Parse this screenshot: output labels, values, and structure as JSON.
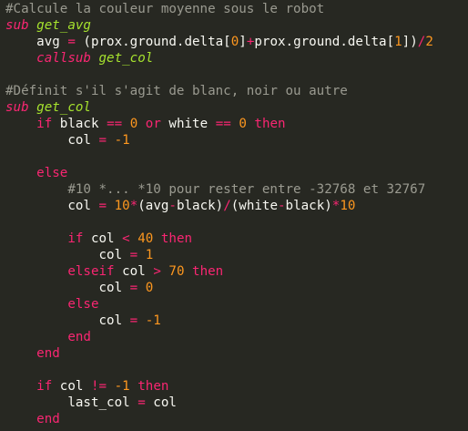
{
  "editor": {
    "lines": [
      [
        {
          "t": "#Calcule la couleur moyenne sous le robot",
          "c": "cm"
        }
      ],
      [
        {
          "t": "sub",
          "c": "sub"
        },
        {
          "t": " ",
          "c": "tx"
        },
        {
          "t": "get_avg",
          "c": "fn"
        }
      ],
      [
        {
          "t": "    avg ",
          "c": "tx"
        },
        {
          "t": "=",
          "c": "op"
        },
        {
          "t": " (prox.ground.delta[",
          "c": "tx"
        },
        {
          "t": "0",
          "c": "nm"
        },
        {
          "t": "]",
          "c": "tx"
        },
        {
          "t": "+",
          "c": "op"
        },
        {
          "t": "prox.ground.delta[",
          "c": "tx"
        },
        {
          "t": "1",
          "c": "nm"
        },
        {
          "t": "])",
          "c": "tx"
        },
        {
          "t": "/",
          "c": "op"
        },
        {
          "t": "2",
          "c": "nm"
        }
      ],
      [
        {
          "t": "    ",
          "c": "tx"
        },
        {
          "t": "callsub",
          "c": "sub"
        },
        {
          "t": " ",
          "c": "tx"
        },
        {
          "t": "get_col",
          "c": "fn"
        }
      ],
      [
        {
          "t": "",
          "c": "tx"
        }
      ],
      [
        {
          "t": "#Définit s'il s'agit de blanc, noir ou autre",
          "c": "cm"
        }
      ],
      [
        {
          "t": "sub",
          "c": "sub"
        },
        {
          "t": " ",
          "c": "tx"
        },
        {
          "t": "get_col",
          "c": "fn"
        }
      ],
      [
        {
          "t": "    ",
          "c": "tx"
        },
        {
          "t": "if",
          "c": "kw"
        },
        {
          "t": " black ",
          "c": "tx"
        },
        {
          "t": "==",
          "c": "op"
        },
        {
          "t": " ",
          "c": "tx"
        },
        {
          "t": "0",
          "c": "nm"
        },
        {
          "t": " ",
          "c": "tx"
        },
        {
          "t": "or",
          "c": "kw"
        },
        {
          "t": " white ",
          "c": "tx"
        },
        {
          "t": "==",
          "c": "op"
        },
        {
          "t": " ",
          "c": "tx"
        },
        {
          "t": "0",
          "c": "nm"
        },
        {
          "t": " ",
          "c": "tx"
        },
        {
          "t": "then",
          "c": "kw"
        }
      ],
      [
        {
          "t": "        col ",
          "c": "tx"
        },
        {
          "t": "=",
          "c": "op"
        },
        {
          "t": " ",
          "c": "tx"
        },
        {
          "t": "-1",
          "c": "nm"
        }
      ],
      [
        {
          "t": "",
          "c": "tx"
        }
      ],
      [
        {
          "t": "    ",
          "c": "tx"
        },
        {
          "t": "else",
          "c": "kw"
        }
      ],
      [
        {
          "t": "        #10 *... *10 pour rester entre -32768 et 32767",
          "c": "cm"
        }
      ],
      [
        {
          "t": "        col ",
          "c": "tx"
        },
        {
          "t": "=",
          "c": "op"
        },
        {
          "t": " ",
          "c": "tx"
        },
        {
          "t": "10",
          "c": "nm"
        },
        {
          "t": "*",
          "c": "op"
        },
        {
          "t": "(avg",
          "c": "tx"
        },
        {
          "t": "-",
          "c": "op"
        },
        {
          "t": "black)",
          "c": "tx"
        },
        {
          "t": "/",
          "c": "op"
        },
        {
          "t": "(white",
          "c": "tx"
        },
        {
          "t": "-",
          "c": "op"
        },
        {
          "t": "black)",
          "c": "tx"
        },
        {
          "t": "*",
          "c": "op"
        },
        {
          "t": "10",
          "c": "nm"
        }
      ],
      [
        {
          "t": "",
          "c": "tx"
        }
      ],
      [
        {
          "t": "        ",
          "c": "tx"
        },
        {
          "t": "if",
          "c": "kw"
        },
        {
          "t": " col ",
          "c": "tx"
        },
        {
          "t": "<",
          "c": "op"
        },
        {
          "t": " ",
          "c": "tx"
        },
        {
          "t": "40",
          "c": "nm"
        },
        {
          "t": " ",
          "c": "tx"
        },
        {
          "t": "then",
          "c": "kw"
        }
      ],
      [
        {
          "t": "            col ",
          "c": "tx"
        },
        {
          "t": "=",
          "c": "op"
        },
        {
          "t": " ",
          "c": "tx"
        },
        {
          "t": "1",
          "c": "nm"
        }
      ],
      [
        {
          "t": "        ",
          "c": "tx"
        },
        {
          "t": "elseif",
          "c": "kw"
        },
        {
          "t": " col ",
          "c": "tx"
        },
        {
          "t": ">",
          "c": "op"
        },
        {
          "t": " ",
          "c": "tx"
        },
        {
          "t": "70",
          "c": "nm"
        },
        {
          "t": " ",
          "c": "tx"
        },
        {
          "t": "then",
          "c": "kw"
        }
      ],
      [
        {
          "t": "            col ",
          "c": "tx"
        },
        {
          "t": "=",
          "c": "op"
        },
        {
          "t": " ",
          "c": "tx"
        },
        {
          "t": "0",
          "c": "nm"
        }
      ],
      [
        {
          "t": "        ",
          "c": "tx"
        },
        {
          "t": "else",
          "c": "kw"
        }
      ],
      [
        {
          "t": "            col ",
          "c": "tx"
        },
        {
          "t": "=",
          "c": "op"
        },
        {
          "t": " ",
          "c": "tx"
        },
        {
          "t": "-1",
          "c": "nm"
        }
      ],
      [
        {
          "t": "        ",
          "c": "tx"
        },
        {
          "t": "end",
          "c": "kw"
        }
      ],
      [
        {
          "t": "    ",
          "c": "tx"
        },
        {
          "t": "end",
          "c": "kw"
        }
      ],
      [
        {
          "t": "",
          "c": "tx"
        }
      ],
      [
        {
          "t": "    ",
          "c": "tx"
        },
        {
          "t": "if",
          "c": "kw"
        },
        {
          "t": " col ",
          "c": "tx"
        },
        {
          "t": "!=",
          "c": "op"
        },
        {
          "t": " ",
          "c": "tx"
        },
        {
          "t": "-1",
          "c": "nm"
        },
        {
          "t": " ",
          "c": "tx"
        },
        {
          "t": "then",
          "c": "kw"
        }
      ],
      [
        {
          "t": "        last_col ",
          "c": "tx"
        },
        {
          "t": "=",
          "c": "op"
        },
        {
          "t": " col",
          "c": "tx"
        }
      ],
      [
        {
          "t": "    ",
          "c": "tx"
        },
        {
          "t": "end",
          "c": "kw"
        }
      ]
    ]
  }
}
